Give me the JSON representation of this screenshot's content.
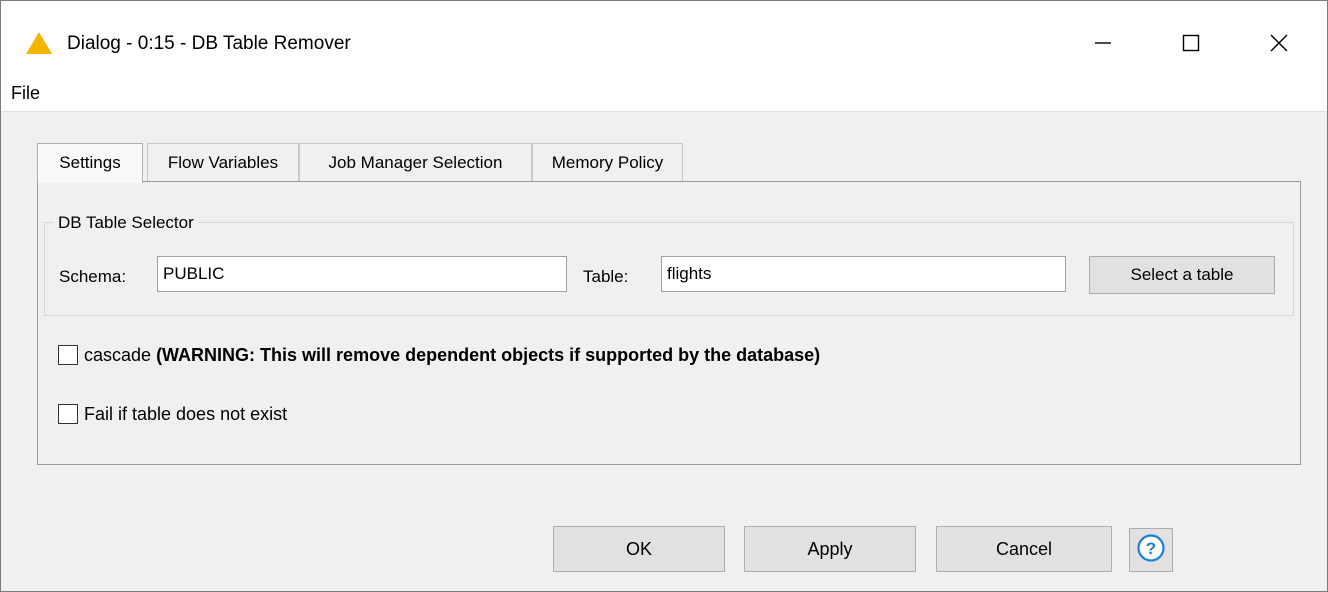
{
  "window": {
    "title": "Dialog - 0:15 - DB Table Remover",
    "icon": "knime-warning-triangle-icon",
    "controls": [
      "minimize-icon",
      "maximize-icon",
      "close-icon"
    ]
  },
  "menu": {
    "file_label": "File"
  },
  "tabs": [
    {
      "label": "Settings",
      "active": true
    },
    {
      "label": "Flow Variables",
      "active": false
    },
    {
      "label": "Job Manager Selection",
      "active": false
    },
    {
      "label": "Memory Policy",
      "active": false
    }
  ],
  "table_selector": {
    "legend": "DB Table Selector",
    "schema_label": "Schema:",
    "schema_value": "PUBLIC",
    "table_label": "Table:",
    "table_value": "flights",
    "select_button_label": "Select a table"
  },
  "options": {
    "cascade_label": "cascade",
    "cascade_warning": "(WARNING: This will remove dependent objects if supported by the database)",
    "cascade_checked": false,
    "fail_label": "Fail if table does not exist",
    "fail_checked": false
  },
  "footer": {
    "ok_label": "OK",
    "apply_label": "Apply",
    "cancel_label": "Cancel",
    "help_icon": "help-icon"
  },
  "colors": {
    "window_bg": "#f0f0f0",
    "titlebar_bg": "#ffffff",
    "icon_yellow": "#f4b400",
    "help_blue": "#1e7fd8",
    "button_bg": "#e1e1e1"
  }
}
